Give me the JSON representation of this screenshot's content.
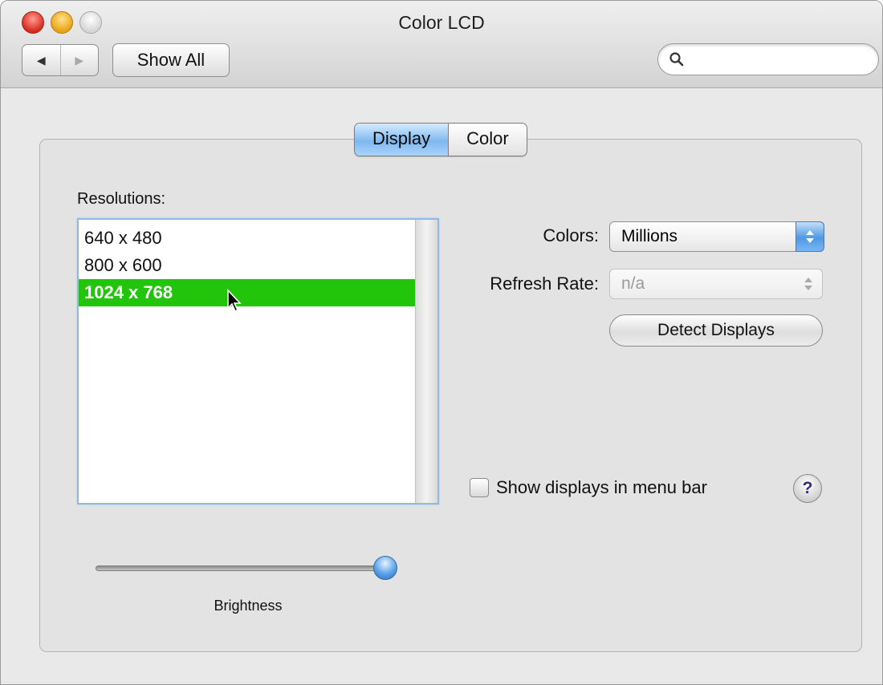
{
  "window": {
    "title": "Color LCD"
  },
  "toolbar": {
    "back_glyph": "◀",
    "forward_glyph": "▶",
    "show_all_label": "Show All",
    "search_placeholder": "",
    "search_value": ""
  },
  "tabs": [
    {
      "label": "Display",
      "selected": true
    },
    {
      "label": "Color",
      "selected": false
    }
  ],
  "resolutions": {
    "label": "Resolutions:",
    "items": [
      "640 x 480",
      "800 x 600",
      "1024 x 768"
    ],
    "selected_index": 2,
    "selection_color": "#23c40c"
  },
  "colors_row": {
    "label": "Colors:",
    "value": "Millions"
  },
  "refresh_row": {
    "label": "Refresh Rate:",
    "value": "n/a"
  },
  "detect_label": "Detect Displays",
  "menu_bar_checkbox": {
    "label": "Show displays in menu bar",
    "checked": false
  },
  "help_glyph": "?",
  "brightness": {
    "label": "Brightness",
    "level": 1.0
  }
}
